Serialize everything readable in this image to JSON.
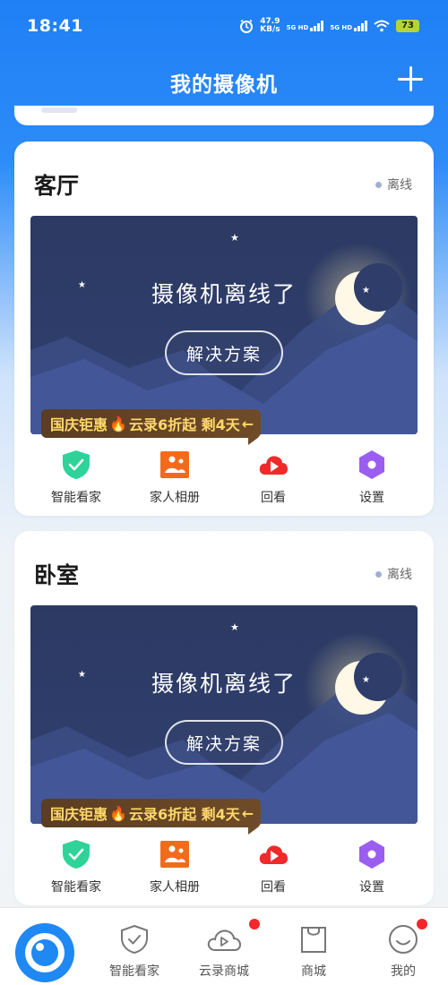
{
  "status_bar": {
    "time": "18:41",
    "net_speed_value": "47.9",
    "net_speed_unit": "KB/s",
    "sim1": "5G HD",
    "sim2": "5G HD",
    "battery": "73"
  },
  "header": {
    "title": "我的摄像机",
    "add_icon": "plus-icon"
  },
  "cameras": [
    {
      "name": "客厅",
      "status": "离线",
      "offline_message": "摄像机离线了",
      "solve_button": "解决方案",
      "promo": {
        "prefix": "国庆钜惠",
        "emoji": "🔥",
        "text": "云录6折起 剩4天",
        "arrow": "←"
      },
      "actions": [
        {
          "label": "智能看家",
          "icon": "shield-check-icon",
          "color": "#2fd39a"
        },
        {
          "label": "家人相册",
          "icon": "photo-album-icon",
          "color": "#f26b1d"
        },
        {
          "label": "回看",
          "icon": "cloud-play-icon",
          "color": "#ef2a2a"
        },
        {
          "label": "设置",
          "icon": "settings-hexagon-icon",
          "color": "#9b5df0"
        }
      ]
    },
    {
      "name": "卧室",
      "status": "离线",
      "offline_message": "摄像机离线了",
      "solve_button": "解决方案",
      "promo": {
        "prefix": "国庆钜惠",
        "emoji": "🔥",
        "text": "云录6折起 剩4天",
        "arrow": "←"
      },
      "actions": [
        {
          "label": "智能看家",
          "icon": "shield-check-icon",
          "color": "#2fd39a"
        },
        {
          "label": "家人相册",
          "icon": "photo-album-icon",
          "color": "#f26b1d"
        },
        {
          "label": "回看",
          "icon": "cloud-play-icon",
          "color": "#ef2a2a"
        },
        {
          "label": "设置",
          "icon": "settings-hexagon-icon",
          "color": "#9b5df0"
        }
      ]
    }
  ],
  "bottom_nav": {
    "home_icon": "eye-logo-icon",
    "items": [
      {
        "label": "智能看家",
        "icon": "shield-check-outline-icon",
        "badge": false
      },
      {
        "label": "云录商城",
        "icon": "cloud-play-outline-icon",
        "badge": true
      },
      {
        "label": "商城",
        "icon": "shopping-bag-icon",
        "badge": false
      },
      {
        "label": "我的",
        "icon": "smiley-face-icon",
        "badge": true
      }
    ]
  },
  "colors": {
    "primary_blue": "#1f88f2",
    "badge_red": "#f3262c",
    "promo_text": "#ffd86a",
    "preview_bg": "#2e3d6a"
  }
}
